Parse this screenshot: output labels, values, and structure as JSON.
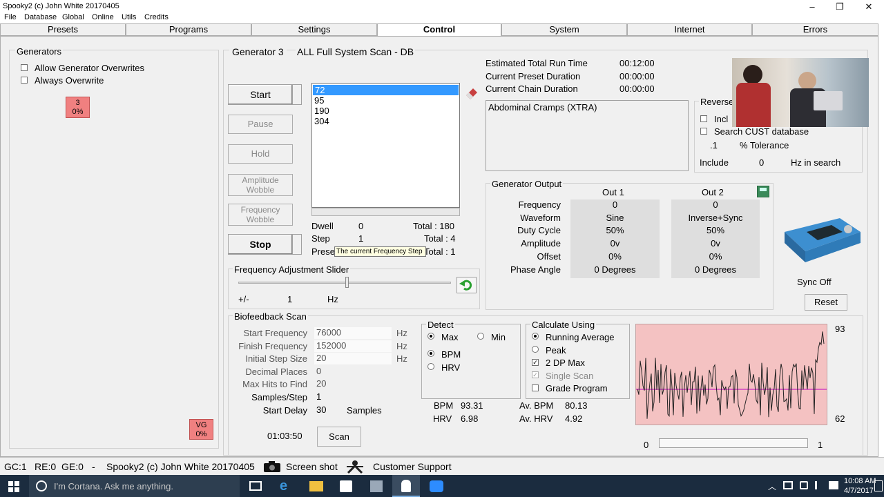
{
  "window": {
    "title": "Spooky2 (c) John White 20170405",
    "min": "–",
    "max": "❐",
    "close": "✕"
  },
  "menu": [
    "File",
    "Database",
    "Global",
    "Online",
    "Utils",
    "Credits"
  ],
  "tabs": [
    "Presets",
    "Programs",
    "Settings",
    "Control",
    "System",
    "Internet",
    "Errors"
  ],
  "generators": {
    "title": "Generators",
    "allow": "Allow Generator Overwrites",
    "always": "Always Overwrite",
    "gen_badge_num": "3",
    "gen_badge_pct": "0%",
    "vg_label": "VG",
    "vg_pct": "0%"
  },
  "gen": {
    "title": "Generator 3",
    "program": "ALL Full System Scan - DB",
    "buttons": {
      "start": "Start",
      "pause": "Pause",
      "hold": "Hold",
      "amp_wobble": "Amplitude Wobble",
      "freq_wobble": "Frequency Wobble",
      "stop": "Stop"
    },
    "list": [
      "72",
      "95",
      "190",
      "304"
    ],
    "dwell_label": "Dwell",
    "dwell_val": "0",
    "dwell_total": "Total : 180",
    "step_label": "Step",
    "step_val": "1",
    "step_total": "Total : 4",
    "preset_label": "Prese",
    "preset_total": "Total : 1",
    "tooltip": "The current Frequency Step"
  },
  "times": {
    "est_label": "Estimated Total Run Time",
    "est_val": "00:12:00",
    "preset_label": "Current Preset Duration",
    "preset_val": "00:00:00",
    "chain_label": "Current Chain Duration",
    "chain_val": "00:00:00"
  },
  "program_text": "Abdominal Cramps (XTRA)",
  "reverse": {
    "title": "Reverse",
    "incl": "Incl",
    "search_cust": "Search CUST database",
    "tolerance_val": ".1",
    "tolerance_label": "% Tolerance",
    "include_label": "Include",
    "include_val": "0",
    "hz_search": "Hz in search"
  },
  "slider": {
    "title": "Frequency Adjustment Slider",
    "pm": "+/-",
    "val": "1",
    "unit": "Hz"
  },
  "output": {
    "title": "Generator Output",
    "out1": "Out 1",
    "out2": "Out 2",
    "rows": [
      {
        "label": "Frequency",
        "o1": "0",
        "o2": "0"
      },
      {
        "label": "Waveform",
        "o1": "Sine",
        "o2": "Inverse+Sync"
      },
      {
        "label": "Duty Cycle",
        "o1": "50%",
        "o2": "50%"
      },
      {
        "label": "Amplitude",
        "o1": "0v",
        "o2": "0v"
      },
      {
        "label": "Offset",
        "o1": "0%",
        "o2": "0%"
      },
      {
        "label": "Phase Angle",
        "o1": "0 Degrees",
        "o2": "0 Degrees"
      }
    ]
  },
  "sync": {
    "label": "Sync Off",
    "reset": "Reset"
  },
  "bio": {
    "title": "Biofeedback Scan",
    "start_label": "Start Frequency",
    "start_val": "76000",
    "finish_label": "Finish Frequency",
    "finish_val": "152000",
    "step_label": "Initial Step Size",
    "step_val": "20",
    "dec_label": "Decimal Places",
    "dec_val": "0",
    "hits_label": "Max Hits to Find",
    "hits_val": "20",
    "sps_label": "Samples/Step",
    "sps_val": "1",
    "delay_label": "Start Delay",
    "delay_val": "30",
    "samples": "Samples",
    "hz": "Hz",
    "time": "01:03:50",
    "scan": "Scan"
  },
  "detect": {
    "title": "Detect",
    "max": "Max",
    "min": "Min",
    "bpm": "BPM",
    "hrv": "HRV"
  },
  "calc": {
    "title": "Calculate Using",
    "ra": "Running Average",
    "peak": "Peak",
    "dp": "2 DP Max",
    "single": "Single Scan",
    "grade": "Grade Program"
  },
  "stats": {
    "bpm_label": "BPM",
    "bpm_val": "93.31",
    "hrv_label": "HRV",
    "hrv_val": "6.98",
    "avbpm_label": "Av. BPM",
    "avbpm_val": "80.13",
    "avhrv_label": "Av. HRV",
    "avhrv_val": "4.92"
  },
  "graph": {
    "max": "93",
    "min": "62",
    "x0": "0",
    "x1": "1"
  },
  "status": {
    "gc": "GC:1",
    "re": "RE:0",
    "ge": "GE:0",
    "dash": "-",
    "app": "Spooky2 (c) John White 20170405",
    "screenshot": "Screen shot",
    "support": "Customer Support"
  },
  "taskbar": {
    "cortana": "I'm Cortana. Ask me anything.",
    "time": "10:08 AM",
    "date": "4/7/2017"
  },
  "colors": {
    "selection": "#3399ff",
    "badge": "#f08080",
    "graph_bg": "#f4c2c2",
    "taskbar": "#1b2c3f"
  }
}
